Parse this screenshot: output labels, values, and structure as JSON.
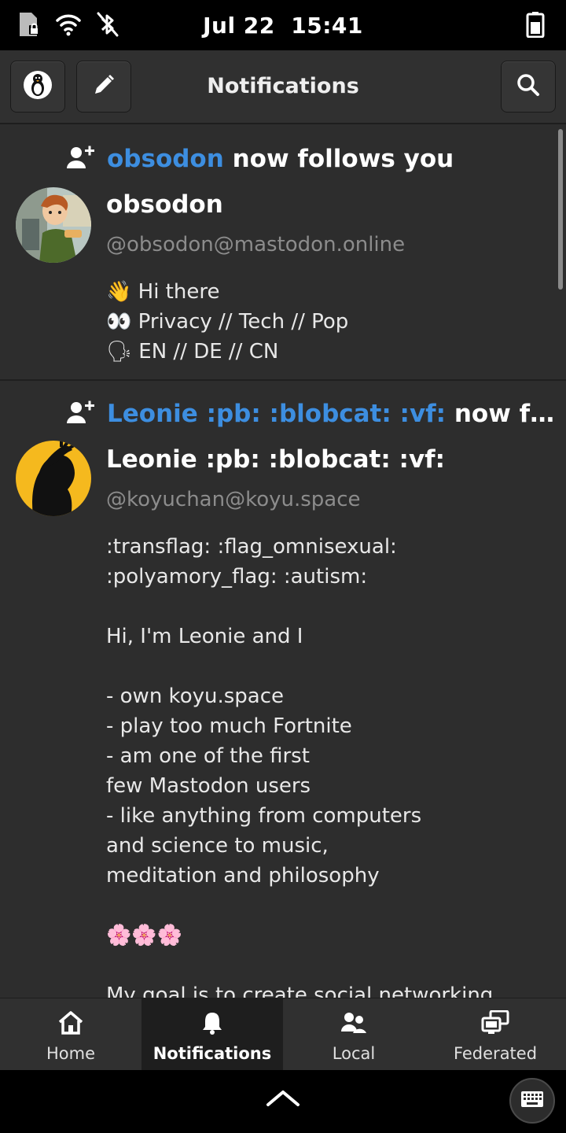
{
  "status_bar": {
    "date": "Jul 22",
    "time": "15:41",
    "icons": [
      "sim-locked-icon",
      "wifi-icon",
      "bluetooth-disabled-icon",
      "battery-icon"
    ]
  },
  "header": {
    "title": "Notifications",
    "left_buttons": [
      "account-avatar-icon",
      "compose-icon"
    ],
    "right_buttons": [
      "search-icon"
    ]
  },
  "notifications": [
    {
      "type_icon": "follow-icon",
      "actor": "obsodon",
      "action": "now follows you",
      "display_name": "obsodon",
      "handle": "@obsodon@mastodon.online",
      "bio": [
        "👋 Hi there",
        "👀 Privacy // Tech // Pop",
        "🗣 EN // DE // CN"
      ]
    },
    {
      "type_icon": "follow-icon",
      "actor": "Leonie :pb: :blobcat: :vf:",
      "action": "now follo…",
      "display_name": "Leonie :pb: :blobcat: :vf:",
      "handle": "@koyuchan@koyu.space",
      "bio": [
        ":transflag: :flag_omnisexual:",
        ":polyamory_flag: :autism:",
        "",
        "Hi, I'm Leonie and I",
        "",
        "- own koyu.space",
        "- play too much Fortnite",
        "- am one of the first",
        "few Mastodon users",
        "- like anything from computers",
        "and science to music,",
        "meditation and philosophy",
        "",
        "🌸🌸🌸",
        "",
        "My goal is to create social networking"
      ]
    }
  ],
  "tabs": [
    {
      "label": "Home",
      "icon": "home-icon",
      "active": false
    },
    {
      "label": "Notifications",
      "icon": "bell-icon",
      "active": true
    },
    {
      "label": "Local",
      "icon": "users-icon",
      "active": false
    },
    {
      "label": "Federated",
      "icon": "federated-icon",
      "active": false
    }
  ],
  "accent_color": "#3d8ee0"
}
